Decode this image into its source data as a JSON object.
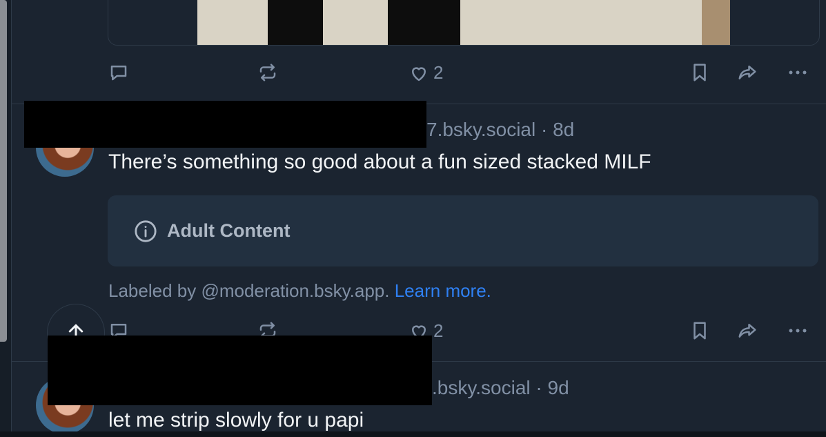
{
  "post1": {
    "like_count": "2"
  },
  "post2": {
    "handle_suffix": "7.bsky.social · 8d",
    "text": "There’s something so good about a fun sized stacked MILF",
    "warning_label": "Adult Content",
    "labeled_by": "Labeled by @moderation.bsky.app. ",
    "learn_more": "Learn more.",
    "like_count": "2"
  },
  "post3": {
    "handle_suffix": ".bsky.social · 9d",
    "text": "let me strip slowly for u papi"
  },
  "colors": {
    "background": "#161e27",
    "feed": "#1b2430",
    "muted": "#8190a5",
    "link": "#2f80f2",
    "warning_box": "#223040"
  },
  "icons": [
    "reply-icon",
    "repost-icon",
    "like-icon",
    "bookmark-icon",
    "share-icon",
    "more-icon",
    "info-icon",
    "arrow-up-icon"
  ]
}
